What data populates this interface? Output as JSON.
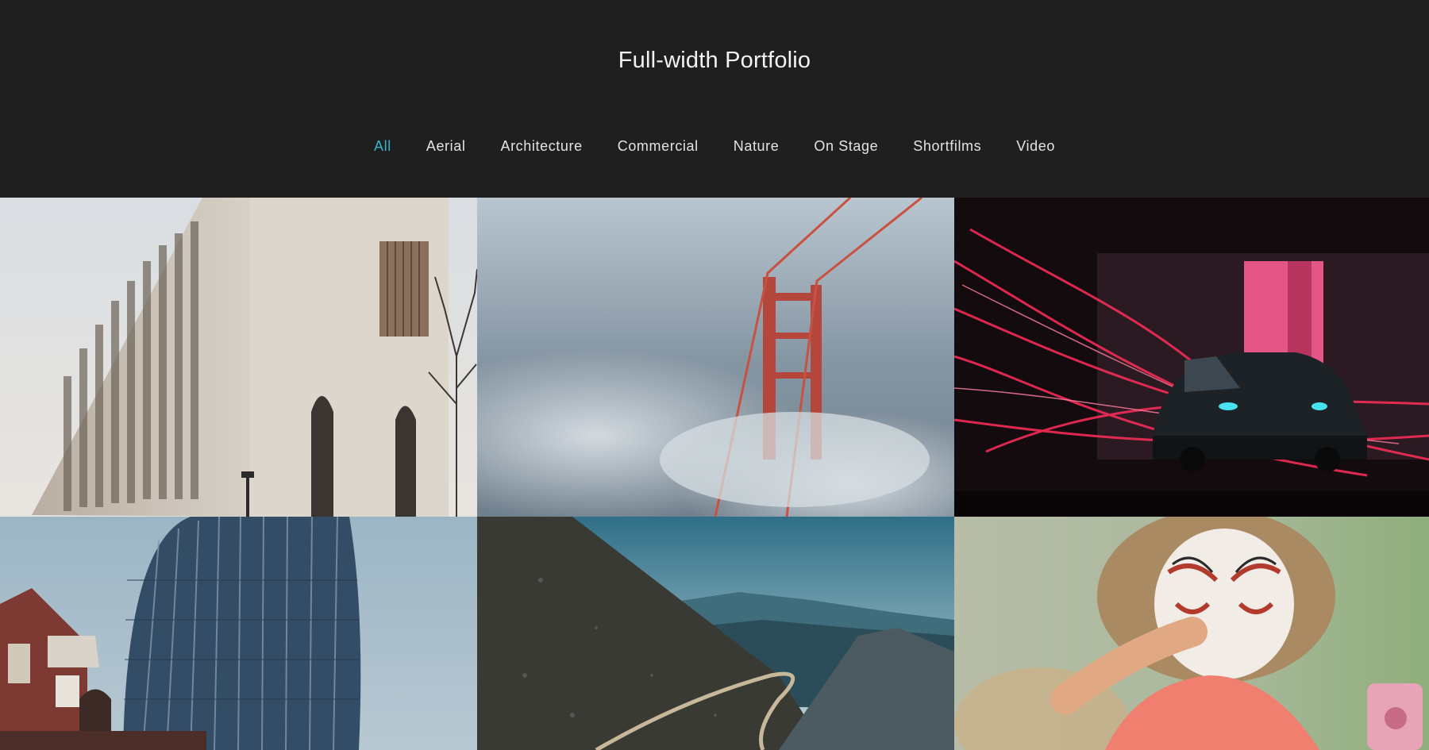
{
  "header": {
    "title": "Full-width Portfolio"
  },
  "filters": [
    {
      "label": "All",
      "active": true
    },
    {
      "label": "Aerial",
      "active": false
    },
    {
      "label": "Architecture",
      "active": false
    },
    {
      "label": "Commercial",
      "active": false
    },
    {
      "label": "Nature",
      "active": false
    },
    {
      "label": "On Stage",
      "active": false
    },
    {
      "label": "Shortfilms",
      "active": false
    },
    {
      "label": "Video",
      "active": false
    }
  ],
  "colors": {
    "background": "#1f1f1f",
    "title": "#f2f2f2",
    "filter_text": "#e3e3e3",
    "filter_active": "#35b3c9"
  },
  "gallery": [
    {
      "subject": "brick-building-photo"
    },
    {
      "subject": "foggy-bridge-photo"
    },
    {
      "subject": "red-light-car-photo"
    },
    {
      "subject": "glass-tower-photo"
    },
    {
      "subject": "mountain-road-photo"
    },
    {
      "subject": "face-paint-child-photo"
    }
  ]
}
